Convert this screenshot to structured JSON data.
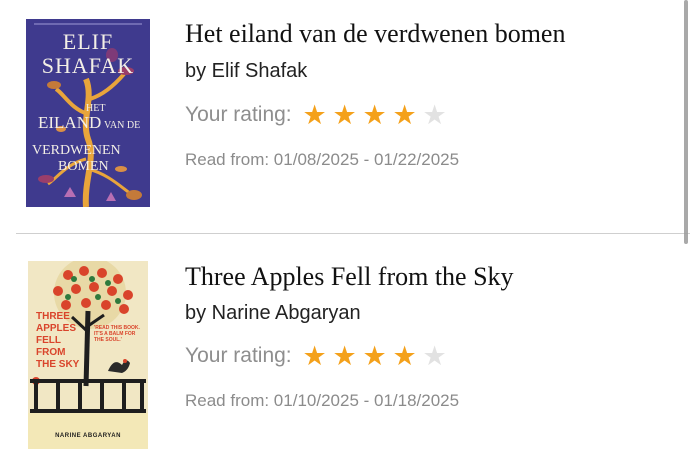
{
  "books": [
    {
      "title": "Het eiland van de verdwenen bomen",
      "author_line": "by Elif Shafak",
      "rating_label": "Your rating:",
      "rating": 4,
      "rating_max": 5,
      "read_dates": "Read from: 01/08/2025 - 01/22/2025",
      "cover": {
        "author_upper": "ELIF",
        "author_lower": "SHAFAK",
        "title_lines": [
          "HET",
          "EILAND",
          "VAN DE",
          "VERDWENEN",
          "BOMEN"
        ],
        "bg_color": "#3f3a8e",
        "accent_color": "#e9a53b"
      }
    },
    {
      "title": "Three Apples Fell from the Sky",
      "author_line": "by Narine Abgaryan",
      "rating_label": "Your rating:",
      "rating": 4,
      "rating_max": 5,
      "read_dates": "Read from: 01/10/2025 - 01/18/2025",
      "cover": {
        "title_lines": [
          "THREE",
          "APPLES",
          "FELL",
          "FROM",
          "THE SKY"
        ],
        "quote": "'READ THIS BOOK. IT'S A BALM FOR THE SOUL.'",
        "author_name": "NARINE ABGARYAN",
        "bg_color": "#f1e7c4",
        "accent_color": "#d9442b"
      }
    }
  ],
  "colors": {
    "star_filled": "#f4a11b",
    "star_empty": "#e2e2e2",
    "muted_text": "#8e8e8e"
  }
}
